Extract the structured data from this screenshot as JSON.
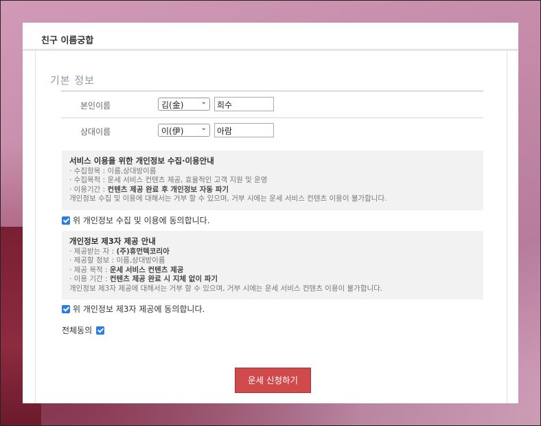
{
  "panel": {
    "title": "친구 이름궁합"
  },
  "form": {
    "section_title": "기본 정보",
    "self": {
      "label": "본인이름",
      "surname": "김(金)",
      "name": "희수"
    },
    "partner": {
      "label": "상대이름",
      "surname": "이(伊)",
      "name": "아람"
    }
  },
  "privacy_collect": {
    "title": "서비스 이용을 위한 개인정보 수집·이용안내",
    "line1": "· 수집항목 : 이름,상대방이름",
    "line2": "· 수집목적 : 운세 서비스 컨텐츠 제공, 효율적인 고객 지원 및 운영",
    "line3_prefix": "· 이용기간 : ",
    "line3_bold": "컨텐츠 제공 완료 후 개인정보 자동 파기",
    "line4": "개인정보 수집 및 이용에 대해서는 거부 할 수 있으며, 거부 시에는 운세 서비스 컨텐츠 이용이 불가합니다.",
    "agree_label": "위 개인정보 수집 및 이용에 동의합니다."
  },
  "privacy_third": {
    "title": "개인정보 제3자 제공 안내",
    "line1_prefix": "· 제공받는 자 : ",
    "line1_bold": "(주)휴먼텍코리아",
    "line2": "· 제공할 정보 : 이름,상대방이름",
    "line3_prefix": "· 제공 목적 : ",
    "line3_bold": "운세 서비스 컨텐츠 제공",
    "line4_prefix": "· 이용 기간 : ",
    "line4_bold": "컨텐츠 제공 완료 시 지체 없이 파기",
    "line5": "개인정보 제3자 제공에 대해서는 거부 할 수 있으며, 거부 시에는 운세 서비스 컨텐츠 이용이 불가합니다.",
    "agree_label": "위 개인정보 제3자 제공에 동의합니다."
  },
  "agree_all": {
    "label": "전체동의"
  },
  "submit": {
    "label": "운세 신청하기"
  },
  "colors": {
    "button": "#d04a4c",
    "checkbox": "#2a7de1",
    "section_title": "#8a9aa8"
  }
}
